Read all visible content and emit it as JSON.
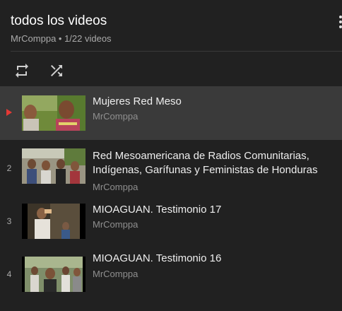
{
  "playlist": {
    "title": "todos los videos",
    "subtitle": "MrComppa • 1/22 videos"
  },
  "controls": {
    "loop_icon": "repeat-icon",
    "shuffle_icon": "shuffle-icon"
  },
  "videos": [
    {
      "index": "",
      "title": "Mujeres Red Meso",
      "channel": "MrComppa",
      "playing": true
    },
    {
      "index": "2",
      "title": "Red Mesoamericana de Radios Comunitarias, Indígenas, Garífunas y Feministas de Honduras",
      "channel": "MrComppa",
      "playing": false
    },
    {
      "index": "3",
      "title": "MIOAGUAN. Testimonio 17",
      "channel": "MrComppa",
      "playing": false
    },
    {
      "index": "4",
      "title": "MIOAGUAN. Testimonio 16",
      "channel": "MrComppa",
      "playing": false
    }
  ],
  "colors": {
    "background": "#212121",
    "active_row": "#3a3a3a",
    "now_playing": "#e53935"
  }
}
